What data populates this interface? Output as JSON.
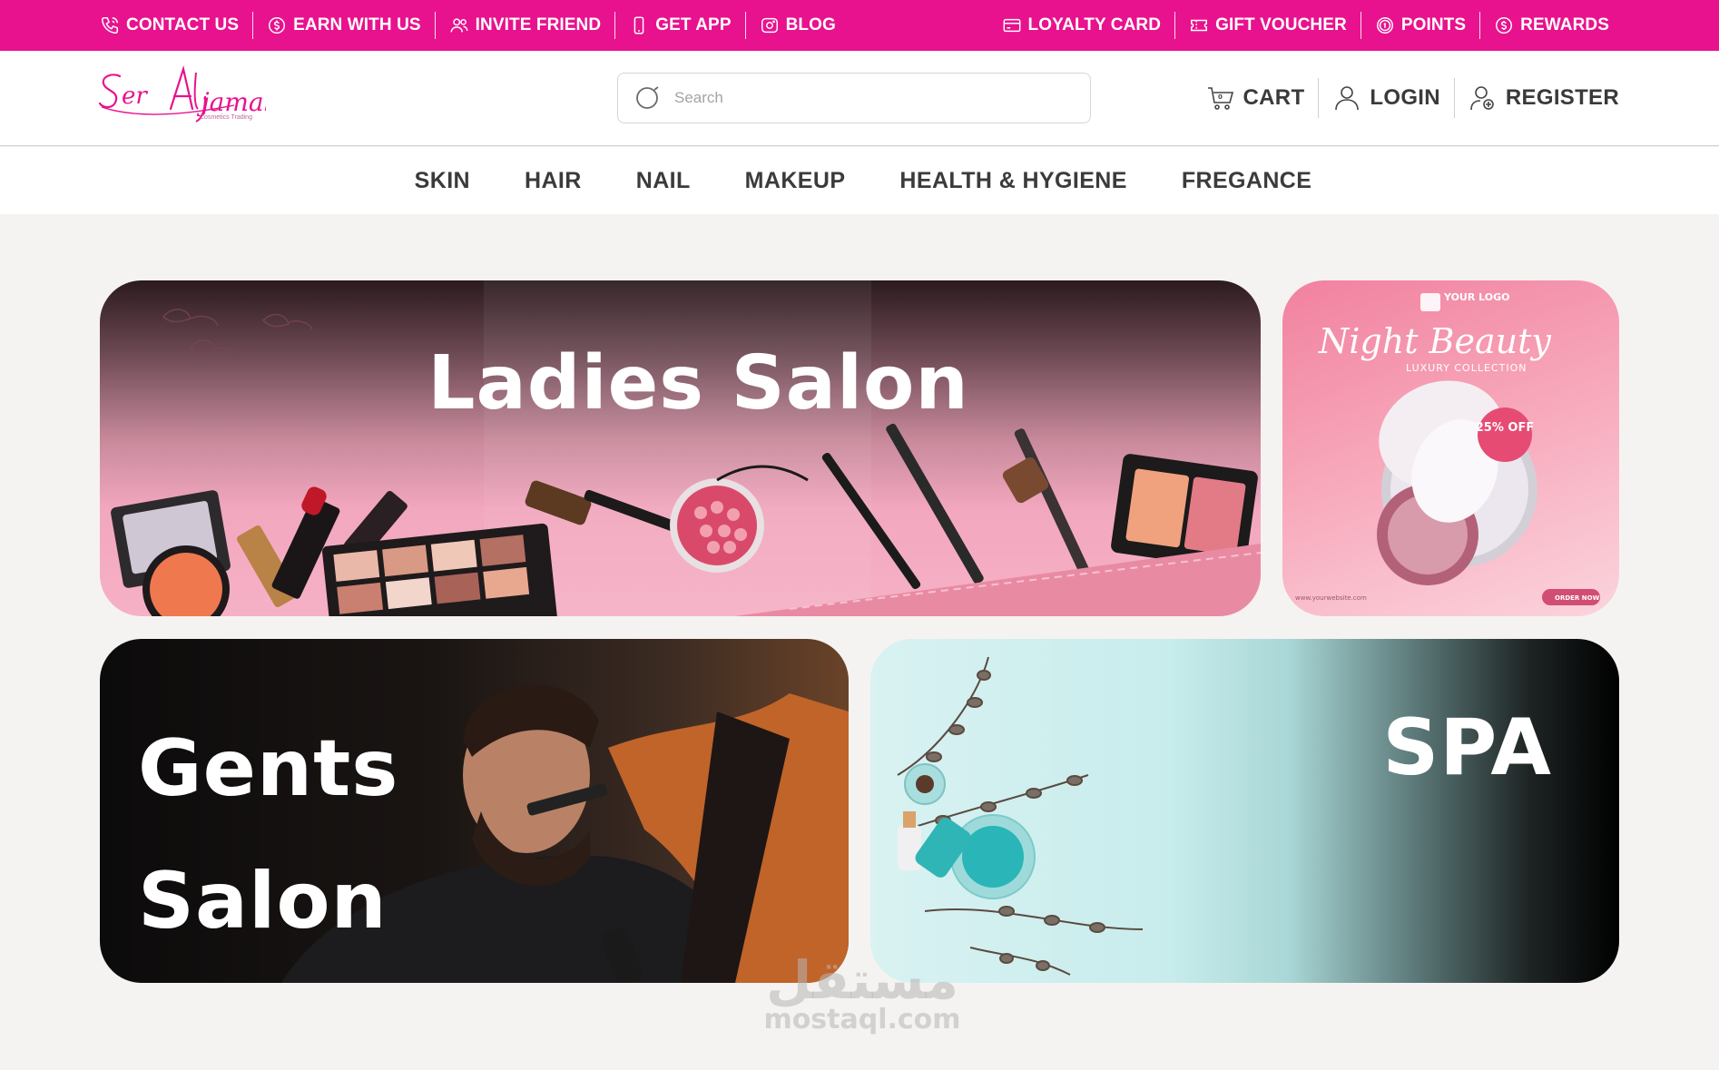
{
  "topbar": {
    "left": [
      {
        "label": "CONTACT US",
        "icon": "phone-icon"
      },
      {
        "label": "EARN WITH US",
        "icon": "money-icon"
      },
      {
        "label": "INVITE FRIEND",
        "icon": "users-icon"
      },
      {
        "label": "GET APP",
        "icon": "mobile-icon"
      },
      {
        "label": "BLOG",
        "icon": "camera-icon"
      }
    ],
    "right": [
      {
        "label": "LOYALTY CARD",
        "icon": "card-icon"
      },
      {
        "label": "GIFT VOUCHER",
        "icon": "voucher-icon"
      },
      {
        "label": "POINTS",
        "icon": "coin-icon"
      },
      {
        "label": "REWARDS",
        "icon": "dollar-icon"
      }
    ]
  },
  "header": {
    "logo": {
      "text": "Ser Aljamal",
      "tagline": "Cosmetics Trading"
    },
    "search": {
      "placeholder": "Search",
      "value": ""
    },
    "cart_label": "CART",
    "login_label": "LOGIN",
    "register_label": "REGISTER"
  },
  "nav": {
    "items": [
      "SKIN",
      "HAIR",
      "NAIL",
      "MAKEUP",
      "HEALTH & HYGIENE",
      "FREGANCE"
    ]
  },
  "cards": {
    "ladies": {
      "title": "Ladies Salon"
    },
    "promo": {
      "logo_text": "YOUR LOGO",
      "headline": "Night Beauty",
      "subtitle": "LUXURY COLLECTION",
      "badge": "25% OFF",
      "website": "www.yourwebsite.com",
      "cta": "ORDER NOW"
    },
    "gents": {
      "title_line1": "Gents",
      "title_line2": "Salon"
    },
    "spa": {
      "title": "SPA"
    }
  },
  "watermark": {
    "arabic": "مستقل",
    "latin": "mostaql.com"
  },
  "colors": {
    "brand_pink": "#e8128e",
    "nav_text": "#3b3b3b",
    "page_bg": "#f5f3f1"
  }
}
